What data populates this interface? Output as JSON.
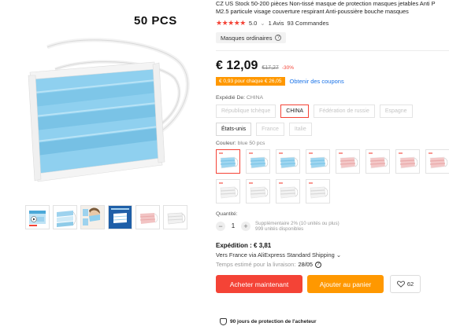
{
  "gallery": {
    "badge_text": "50 PCS",
    "thumbnails": [
      {
        "icon": "mask-box-thumb"
      },
      {
        "icon": "mask-layers-thumb"
      },
      {
        "icon": "mask-person-thumb"
      },
      {
        "icon": "mask-diagram-thumb"
      },
      {
        "icon": "pink-mask-thumb"
      },
      {
        "icon": "white-mask-thumb"
      }
    ]
  },
  "product": {
    "title_line1": "CZ US Stock 50-200 pièces Non-tissé masque de protection masques jetables Anti P",
    "title_line2": "M2.5 particule visage couverture respirant Anti-poussière bouche masques",
    "stars": "★★★★★",
    "rating": "5.0",
    "reviews": "1 Avis",
    "orders": "93 Commandes",
    "store_chip": "Masques ordinaires",
    "price": "€ 12,09",
    "old_price": "€17,27",
    "discount": "-30%",
    "coupon": "€ 0,93 pour chaque € 26,05",
    "coupon_link": "Obtenir des coupons"
  },
  "ship_from": {
    "label": "Expédié De:",
    "value": "CHINA",
    "options": [
      {
        "label": "République tchèque",
        "state": "disabled"
      },
      {
        "label": "CHINA",
        "state": "selected"
      },
      {
        "label": "Fédération de russie",
        "state": "disabled"
      },
      {
        "label": "Espagne",
        "state": "disabled"
      },
      {
        "label": "États-unis",
        "state": "available"
      },
      {
        "label": "France",
        "state": "disabled"
      },
      {
        "label": "Italie",
        "state": "disabled"
      }
    ]
  },
  "color": {
    "label": "Couleur:",
    "value": "blue 50 pcs",
    "swatches": [
      {
        "kind": "blue",
        "selected": true
      },
      {
        "kind": "blue",
        "selected": false
      },
      {
        "kind": "blue",
        "selected": false
      },
      {
        "kind": "blue",
        "selected": false
      },
      {
        "kind": "pink",
        "selected": false
      },
      {
        "kind": "pink",
        "selected": false
      },
      {
        "kind": "pink",
        "selected": false
      },
      {
        "kind": "pink",
        "selected": false
      },
      {
        "kind": "white",
        "selected": false
      },
      {
        "kind": "white",
        "selected": false
      },
      {
        "kind": "white",
        "selected": false
      },
      {
        "kind": "white",
        "selected": false
      }
    ]
  },
  "quantity": {
    "label": "Quantité:",
    "minus": "−",
    "value": "1",
    "plus": "+",
    "note_line1": "Supplémentaire 2% (10 unités ou plus)",
    "note_line2": "999 unités disponibles"
  },
  "shipping": {
    "title_prefix": "Expédition :",
    "cost": "€ 3,81",
    "via": "Vers France via AliExpress Standard Shipping",
    "via_chevron": "⌄",
    "eta_label": "Temps estimé pour la livraison:",
    "eta_date": "28/05",
    "help_icon": "?"
  },
  "actions": {
    "buy_now": "Acheter maintenant",
    "add_to_cart": "Ajouter au panier",
    "wishlist_count": "62"
  },
  "protection": {
    "text": "90 jours de protection de l'acheteur"
  },
  "colors": {
    "accent_red": "#f44336",
    "accent_orange": "#ff9800",
    "link_blue": "#1a73e8",
    "mask_blue": "#8fd0ef"
  }
}
